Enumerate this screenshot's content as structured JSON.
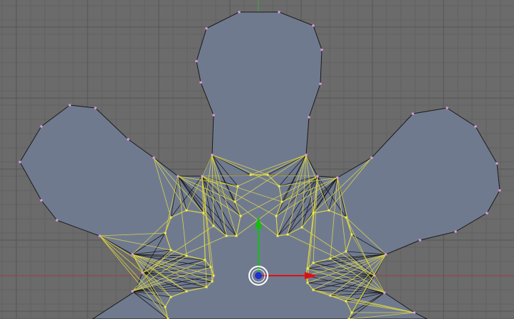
{
  "viewport": {
    "kind": "3d-view-edit-mode",
    "background": "#6b6b6b",
    "grid_minor_color": "#616161",
    "grid_major_color": "#565656",
    "x_axis_color": "#9a4040",
    "y_axis_color": "#3fa93f"
  },
  "mesh": {
    "face_color": "#707a8f",
    "edge_color": "#1a1a1a",
    "selected_edge_color": "#d8d24a",
    "vertex_color": "#e6a0e6",
    "selected_vertex_color": "#f0ee58",
    "petal_count": 5
  },
  "manipulator": {
    "x_arrow_color": "#e01010",
    "y_arrow_color": "#10c010",
    "z_handle_color": "#2030d0",
    "pivot_ring_color": "#ffffff"
  }
}
